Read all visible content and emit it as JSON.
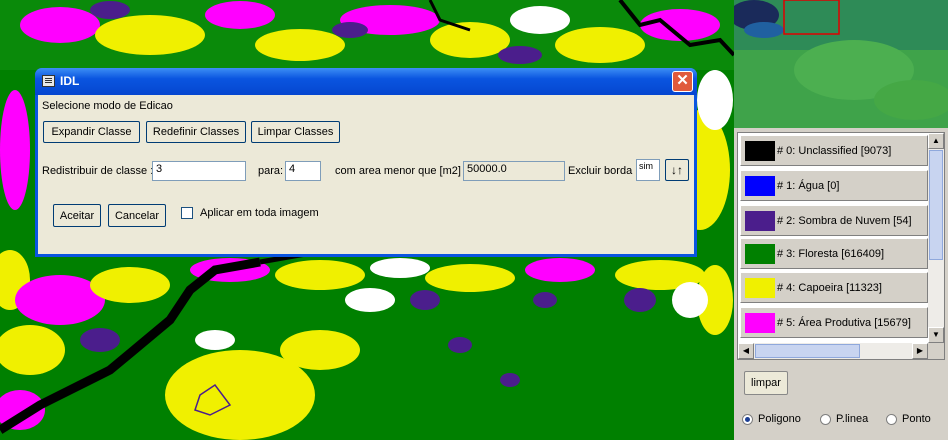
{
  "dialog": {
    "title": "IDL",
    "close_glyph": "✕",
    "mode_label": "Selecione modo de Edicao",
    "buttons": {
      "expand": "Expandir Classe",
      "redefine": "Redefinir Classes",
      "clear": "Limpar Classes",
      "accept": "Aceitar",
      "cancel": "Cancelar"
    },
    "redistribute_label": "Redistribuir de classe :",
    "from_class_value": "3",
    "to_label": "para:",
    "to_class_value": "4",
    "area_label": "com area menor que [m2]",
    "area_value": "50000.0",
    "border_label": "Excluir borda",
    "border_value": "sim",
    "sort_icon": "sort-arrows-icon",
    "apply_all_label": "Aplicar em toda imagem",
    "apply_all_checked": false
  },
  "classes": [
    {
      "label": "# 0: Unclassified  [9073]",
      "color": "#000000"
    },
    {
      "label": "# 1: Água  [0]",
      "color": "#0000ff"
    },
    {
      "label": "# 2: Sombra de Nuvem  [54]",
      "color": "#4b1e8c"
    },
    {
      "label": "# 3: Floresta  [616409]",
      "color": "#008000"
    },
    {
      "label": "# 4: Capoeira  [11323]",
      "color": "#f0f000"
    },
    {
      "label": "# 5: Área Produtiva  [15679]",
      "color": "#ff00ff"
    }
  ],
  "side": {
    "clear_button": "limpar",
    "draw_modes": [
      {
        "label": "Poligono",
        "selected": true
      },
      {
        "label": "P.linea",
        "selected": false
      },
      {
        "label": "Ponto",
        "selected": false
      }
    ]
  },
  "colors": {
    "forest": "#008000",
    "capoeira": "#f0f000",
    "productive": "#ff00ff",
    "shadow": "#4b1e8c",
    "cloud": "#ffffff",
    "unclassified": "#000000",
    "titlebar": "#0a55e0"
  }
}
